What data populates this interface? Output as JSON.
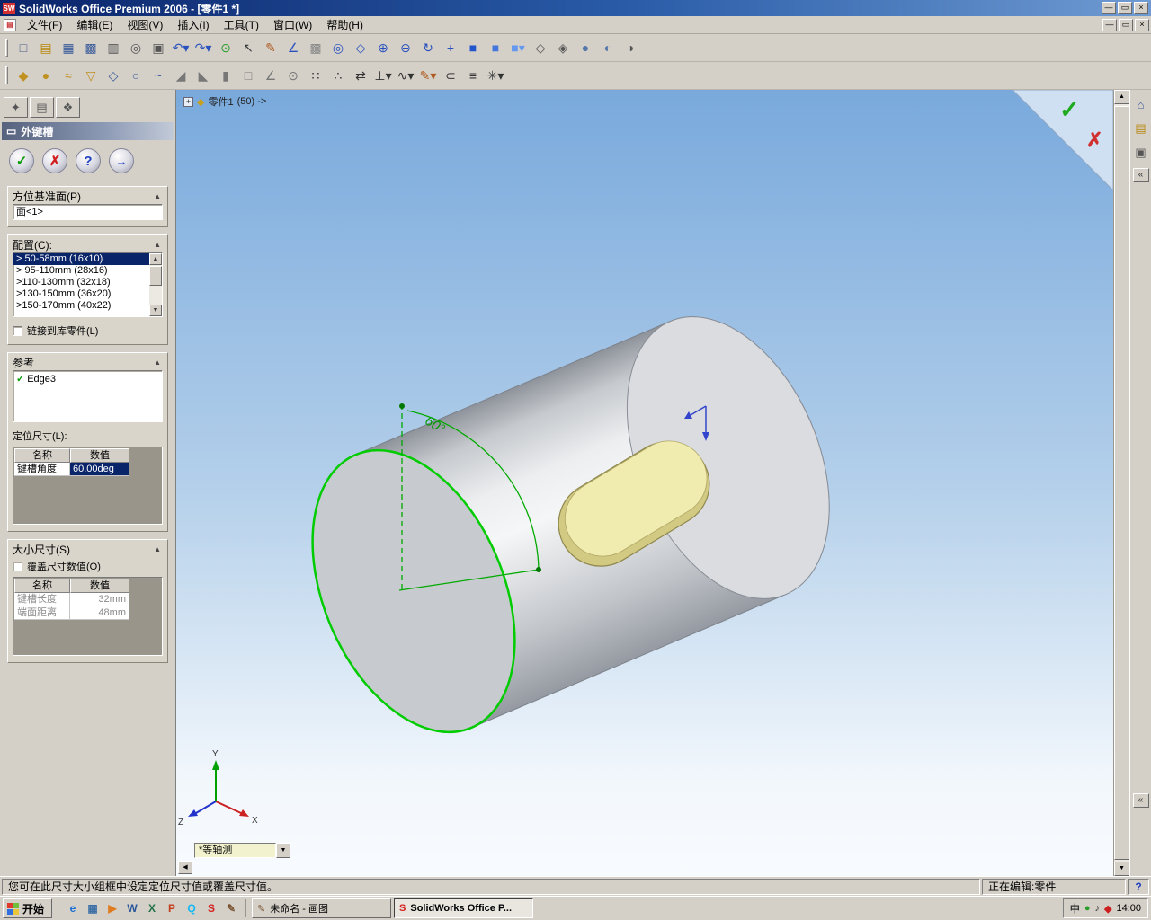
{
  "titlebar": {
    "logo": "SW",
    "title": "SolidWorks Office Premium 2006 - [零件1 *]"
  },
  "icons": {
    "collapse_arrow": "▲",
    "dropdown_arrow": "▼",
    "check": "✓",
    "close": "×",
    "minimize": "—",
    "restore": "▭",
    "scroll_up": "▲",
    "scroll_down": "▼",
    "scroll_left": "◀",
    "chevron": "«",
    "plus": "+",
    "keyway": "▭",
    "part": "◆",
    "doc": "▤"
  },
  "menubar": {
    "items": [
      "文件(F)",
      "编辑(E)",
      "视图(V)",
      "插入(I)",
      "工具(T)",
      "窗口(W)",
      "帮助(H)"
    ]
  },
  "toolbar_standard": {
    "icons": [
      {
        "name": "new-document-icon",
        "glyph": "□",
        "color": "#4a5a8a"
      },
      {
        "name": "open-icon",
        "glyph": "▤",
        "color": "#b8860b"
      },
      {
        "name": "save-icon",
        "glyph": "▦",
        "color": "#3a5a9a"
      },
      {
        "name": "save-all-icon",
        "glyph": "▩",
        "color": "#3a5a9a"
      },
      {
        "name": "print-icon",
        "glyph": "▥",
        "color": "#555555"
      },
      {
        "name": "print-preview-icon",
        "glyph": "◎",
        "color": "#555555"
      },
      {
        "name": "copy-icon",
        "glyph": "▣",
        "color": "#555555"
      },
      {
        "name": "undo-icon",
        "glyph": "↶▾",
        "color": "#2a52be"
      },
      {
        "name": "redo-icon",
        "glyph": "↷▾",
        "color": "#2a52be"
      },
      {
        "name": "rebuild-icon",
        "glyph": "⊙",
        "color": "#2a9d2a"
      },
      {
        "name": "select-arrow-icon",
        "glyph": "↖",
        "color": "#333333"
      },
      {
        "name": "sketch-icon",
        "glyph": "✎",
        "color": "#b05a20"
      },
      {
        "name": "smart-dimension-icon",
        "glyph": "∠",
        "color": "#2a52be"
      },
      {
        "name": "reference-grid-icon",
        "glyph": "▩",
        "color": "#888888"
      },
      {
        "name": "zoom-to-fit-icon",
        "glyph": "◎",
        "color": "#2a52be"
      },
      {
        "name": "zoom-area-icon",
        "glyph": "◇",
        "color": "#2a52be"
      },
      {
        "name": "zoom-in-icon",
        "glyph": "⊕",
        "color": "#2a52be"
      },
      {
        "name": "zoom-out-icon",
        "glyph": "⊖",
        "color": "#2a52be"
      },
      {
        "name": "rotate-view-icon",
        "glyph": "↻",
        "color": "#2a52be"
      },
      {
        "name": "pan-icon",
        "glyph": "+",
        "color": "#2a52be"
      },
      {
        "name": "standard-view-front-icon",
        "glyph": "■",
        "color": "#2255cc"
      },
      {
        "name": "standard-view-iso-icon",
        "glyph": "■",
        "color": "#4477dd"
      },
      {
        "name": "standard-view-more-icon",
        "glyph": "■▾",
        "color": "#6699ee"
      },
      {
        "name": "wireframe-icon",
        "glyph": "◇",
        "color": "#555555"
      },
      {
        "name": "hidden-lines-icon",
        "glyph": "◈",
        "color": "#555555"
      },
      {
        "name": "shaded-icon",
        "glyph": "●",
        "color": "#5577aa"
      },
      {
        "name": "shaded-edges-icon",
        "glyph": "◐",
        "color": "#5577aa"
      },
      {
        "name": "section-view-icon",
        "glyph": "◑",
        "color": "#555555"
      }
    ]
  },
  "toolbar_features": {
    "icons": [
      {
        "name": "extruded-boss-icon",
        "glyph": "◆",
        "color": "#c09020"
      },
      {
        "name": "revolved-boss-icon",
        "glyph": "●",
        "color": "#c09020"
      },
      {
        "name": "swept-boss-icon",
        "glyph": "≈",
        "color": "#c09020"
      },
      {
        "name": "lofted-boss-icon",
        "glyph": "▽",
        "color": "#c09020"
      },
      {
        "name": "extruded-cut-icon",
        "glyph": "◇",
        "color": "#3a5a9a"
      },
      {
        "name": "revolved-cut-icon",
        "glyph": "○",
        "color": "#3a5a9a"
      },
      {
        "name": "swept-cut-icon",
        "glyph": "~",
        "color": "#3a5a9a"
      },
      {
        "name": "fillet-icon",
        "glyph": "◢",
        "color": "#777777"
      },
      {
        "name": "chamfer-icon",
        "glyph": "◣",
        "color": "#777777"
      },
      {
        "name": "rib-icon",
        "glyph": "▮",
        "color": "#777777"
      },
      {
        "name": "shell-icon",
        "glyph": "□",
        "color": "#777777"
      },
      {
        "name": "draft-icon",
        "glyph": "∠",
        "color": "#777777"
      },
      {
        "name": "hole-wizard-icon",
        "glyph": "⊙",
        "color": "#777777"
      },
      {
        "name": "linear-pattern-icon",
        "glyph": "∷",
        "color": "#333333"
      },
      {
        "name": "circular-pattern-icon",
        "glyph": "∴",
        "color": "#333333"
      },
      {
        "name": "mirror-icon",
        "glyph": "⇄",
        "color": "#333333"
      },
      {
        "name": "reference-geometry-icon",
        "glyph": "⊥▾",
        "color": "#333333"
      },
      {
        "name": "curves-icon",
        "glyph": "∿▾",
        "color": "#333333"
      },
      {
        "name": "sketch-entities-icon",
        "glyph": "✎▾",
        "color": "#b05a20"
      },
      {
        "name": "convert-entities-icon",
        "glyph": "⊂",
        "color": "#333333"
      },
      {
        "name": "offset-entities-icon",
        "glyph": "≡",
        "color": "#333333"
      },
      {
        "name": "sketch-relations-icon",
        "glyph": "✳▾",
        "color": "#333333"
      }
    ]
  },
  "property_panel": {
    "tabs": [
      {
        "name": "tab-property-manager",
        "glyph": "✦"
      },
      {
        "name": "tab-configuration",
        "glyph": "▤"
      },
      {
        "name": "tab-dimxpert",
        "glyph": "❖"
      }
    ],
    "title": "外键槽",
    "actions": {
      "ok": "✓",
      "cancel": "✗",
      "help": "?",
      "pin": "→"
    },
    "orientation_group": {
      "label": "方位基准面(P)",
      "field_value": "面<1>"
    },
    "config_group": {
      "label": "配置(C):",
      "items": [
        "> 50-58mm (16x10)",
        "> 95-110mm (28x16)",
        ">110-130mm (32x18)",
        ">130-150mm (36x20)",
        ">150-170mm (40x22)"
      ],
      "link_label": "链接到库零件(L)"
    },
    "reference_group": {
      "label": "参考",
      "reference_value": "Edge3",
      "position_label": "定位尺寸(L):",
      "table": {
        "headers": [
          "名称",
          "数值"
        ],
        "rows": [
          {
            "name": "键槽角度",
            "value": "60.00deg"
          }
        ]
      }
    },
    "size_group": {
      "label": "大小尺寸(S)",
      "override_label": "覆盖尺寸数值(O)",
      "table": {
        "headers": [
          "名称",
          "数值"
        ],
        "rows": [
          {
            "name": "键槽长度",
            "value": "32mm"
          },
          {
            "name": "端面距离",
            "value": "48mm"
          }
        ]
      }
    }
  },
  "viewport": {
    "tree_part": "零件1",
    "tree_suffix": "(50) ->",
    "angle_label": "60°",
    "axis_x": "X",
    "axis_y": "Y",
    "axis_z": "Z",
    "view_selector": "*等轴测",
    "colors": {
      "bg_top": "#79a9dc",
      "bg_bottom": "#f2f7fc",
      "edge_highlight": "#00cc00",
      "slot_face": "#f0ebae",
      "slot_wall": "#d2c982"
    }
  },
  "task_pane": {
    "icons": [
      {
        "name": "solidworks-resources-icon",
        "glyph": "⌂",
        "color": "#3a5a9a"
      },
      {
        "name": "design-library-icon",
        "glyph": "▤",
        "color": "#b8860b"
      },
      {
        "name": "file-explorer-icon",
        "glyph": "▣",
        "color": "#555555"
      }
    ]
  },
  "statusbar": {
    "message": "您可在此尺寸大小组框中设定定位尺寸值或覆盖尺寸值。",
    "mode": "正在编辑:零件",
    "help": "?"
  },
  "taskbar": {
    "start_label": "开始",
    "quicklaunch": [
      {
        "name": "internet-explorer-icon",
        "glyph": "e",
        "color": "#1a6fd4"
      },
      {
        "name": "show-desktop-icon",
        "glyph": "▦",
        "color": "#3a6ea5"
      },
      {
        "name": "media-player-icon",
        "glyph": "▶",
        "color": "#e07c1f"
      },
      {
        "name": "word-icon",
        "glyph": "W",
        "color": "#2a5699"
      },
      {
        "name": "excel-icon",
        "glyph": "X",
        "color": "#1e7145"
      },
      {
        "name": "powerpoint-icon",
        "glyph": "P",
        "color": "#c43e1c"
      },
      {
        "name": "qq-icon",
        "glyph": "Q",
        "color": "#12b7f5"
      },
      {
        "name": "solidworks-quicklaunch-icon",
        "glyph": "S",
        "color": "#d42020"
      },
      {
        "name": "paint-quicklaunch-icon",
        "glyph": "✎",
        "color": "#7a5230"
      }
    ],
    "tasks": [
      {
        "label": "未命名 - 画图",
        "icon": "✎"
      },
      {
        "label": "SolidWorks Office P...",
        "icon": "S"
      }
    ],
    "tray_icons": [
      {
        "name": "language-indicator-icon",
        "glyph": "中",
        "color": "#333333"
      },
      {
        "name": "antivirus-tray-icon",
        "glyph": "●",
        "color": "#2a9d2a"
      },
      {
        "name": "volume-icon",
        "glyph": "♪",
        "color": "#333333"
      },
      {
        "name": "solidworks-tray-icon",
        "glyph": "◆",
        "color": "#cc2020"
      }
    ],
    "time": "14:00"
  }
}
